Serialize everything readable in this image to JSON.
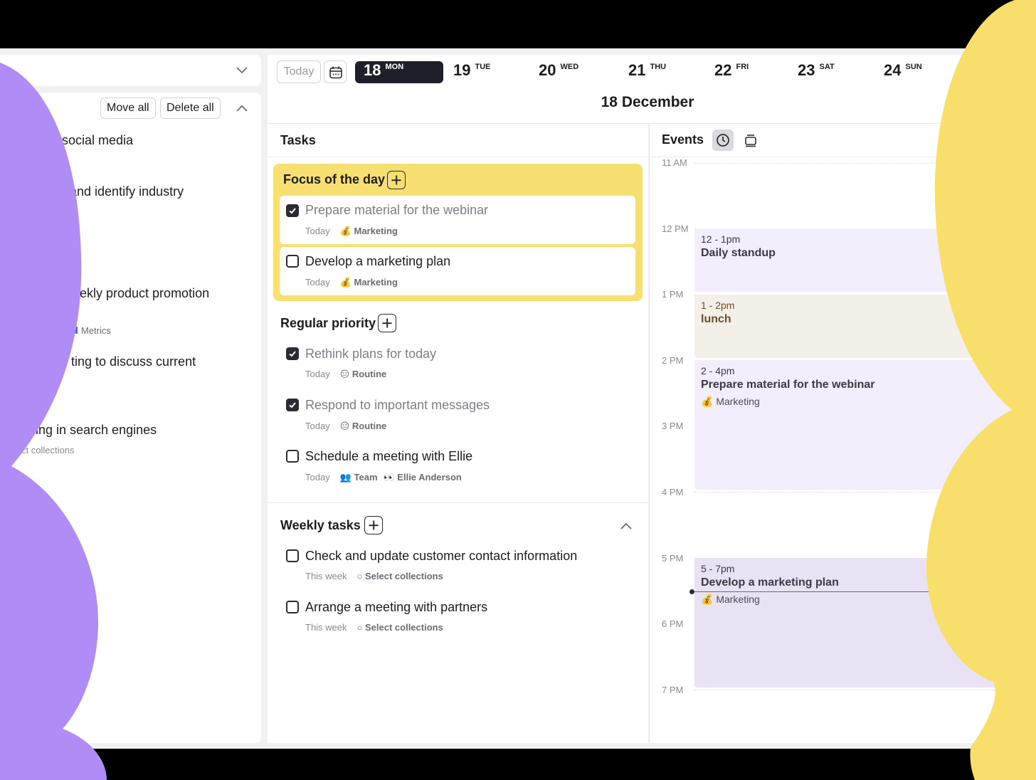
{
  "colors": {
    "accent_dark": "#1f1f2b",
    "focus_yellow": "#f7df72",
    "blob_purple": "#b08cf7",
    "blob_yellow": "#f8de6b"
  },
  "left_panel": {
    "move_all_label": "Move all",
    "delete_all_label": "Delete all",
    "items": [
      {
        "text": "n social media"
      },
      {
        "text": "and identify industry"
      },
      {
        "text": "ekly product promotion",
        "sub": "Metrics"
      },
      {
        "text": "ting to discuss current"
      },
      {
        "text": "ing in search engines",
        "sub": "ct collections"
      }
    ]
  },
  "header": {
    "today_label": "Today",
    "calendar_icon": "calendar-icon",
    "days": [
      {
        "num": "18",
        "dow": "MON",
        "active": true
      },
      {
        "num": "19",
        "dow": "TUE"
      },
      {
        "num": "20",
        "dow": "WED"
      },
      {
        "num": "21",
        "dow": "THU"
      },
      {
        "num": "22",
        "dow": "FRI"
      },
      {
        "num": "23",
        "dow": "SAT"
      },
      {
        "num": "24",
        "dow": "SUN"
      }
    ],
    "date_title": "18 December"
  },
  "tasks": {
    "heading": "Tasks",
    "focus": {
      "title": "Focus of the day",
      "items": [
        {
          "title": "Prepare material for the webinar",
          "done": true,
          "when": "Today",
          "tag": "💰 Marketing"
        },
        {
          "title": "Develop a marketing plan",
          "done": false,
          "when": "Today",
          "tag": "💰 Marketing"
        }
      ]
    },
    "regular": {
      "title": "Regular priority",
      "items": [
        {
          "title": "Rethink plans for today",
          "done": true,
          "when": "Today",
          "tag": "😑 Routine"
        },
        {
          "title": "Respond to important messages",
          "done": true,
          "when": "Today",
          "tag": "😑 Routine"
        },
        {
          "title": "Schedule a meeting with Ellie",
          "done": false,
          "when": "Today",
          "tag": "👥 Team",
          "tag2": "👀 Ellie Anderson"
        }
      ]
    },
    "weekly": {
      "title": "Weekly tasks",
      "items": [
        {
          "title": "Check and update customer contact information",
          "done": false,
          "when": "This week",
          "tag": "○ Select collections"
        },
        {
          "title": "Arrange a meeting with partners",
          "done": false,
          "when": "This week",
          "tag": "○ Select collections"
        }
      ]
    }
  },
  "events": {
    "heading": "Events",
    "hours": [
      "11 AM",
      "12 PM",
      "1 PM",
      "2 PM",
      "3 PM",
      "4 PM",
      "5 PM",
      "6 PM",
      "7 PM"
    ],
    "items": [
      {
        "time": "12 - 1pm",
        "title": "Daily standup",
        "tag": ""
      },
      {
        "time": "1 - 2pm",
        "title": "lunch",
        "tag": ""
      },
      {
        "time": "2 - 4pm",
        "title": "Prepare material for the webinar",
        "tag": "💰 Marketing"
      },
      {
        "time": "5 - 7pm",
        "title": "Develop a marketing plan",
        "tag": "💰 Marketing"
      }
    ]
  }
}
